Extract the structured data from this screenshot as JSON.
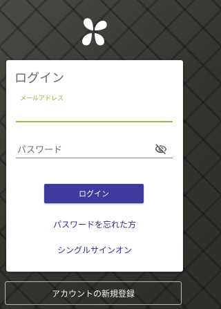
{
  "logo": {
    "icon": "clover-logo-icon"
  },
  "login_card": {
    "title": "ログイン",
    "email": {
      "label": "メールアドレス",
      "value": ""
    },
    "password": {
      "placeholder": "パスワード",
      "visibility_icon": "visibility-off-icon"
    },
    "login_button": "ログイン",
    "forgot_password_link": "パスワードを忘れた方",
    "sso_link": "シングルサインオン"
  },
  "signup_button": "アカウントの新規登録",
  "colors": {
    "primary_button": "#3f3a9c",
    "link": "#2f2f8a",
    "accent_green": "#8bc34a"
  }
}
